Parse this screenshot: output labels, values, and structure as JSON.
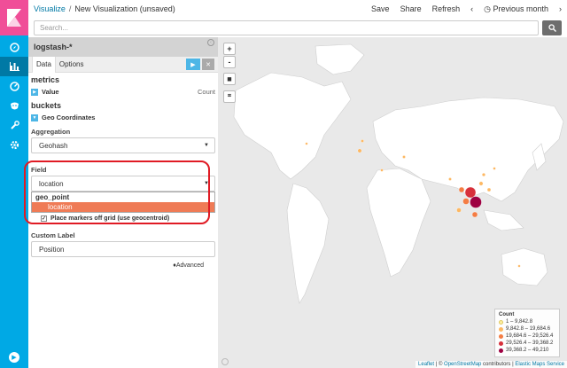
{
  "breadcrumb": {
    "root": "Visualize",
    "separator": "/",
    "current": "New Visualization (unsaved)"
  },
  "top_actions": {
    "save": "Save",
    "share": "Share",
    "refresh": "Refresh",
    "prev": "‹",
    "time_icon": "clock-icon",
    "time": "Previous month",
    "next": "›"
  },
  "search": {
    "placeholder": "Search...",
    "button_icon": "search-icon"
  },
  "nav": {
    "items": [
      "compass-icon",
      "chart-icon",
      "dashboard-icon",
      "timelion-icon",
      "wrench-icon",
      "gear-icon"
    ],
    "bottom_icon": "play-icon"
  },
  "panel": {
    "index_pattern": "logstash-*",
    "tabs": [
      {
        "label": "Data"
      },
      {
        "label": "Options"
      }
    ],
    "metrics_title": "metrics",
    "metric": {
      "label": "Value",
      "type": "Count"
    },
    "buckets_title": "buckets",
    "bucket": {
      "label": "Geo Coordinates"
    },
    "aggregation_label": "Aggregation",
    "aggregation_value": "Geohash",
    "field_label": "Field",
    "field_value": "location",
    "dropdown_group": "geo_point",
    "dropdown_option": "location",
    "checkbox_label": "Place markers off grid (use geocentroid)",
    "custom_label_title": "Custom Label",
    "custom_label_value": "Position",
    "advanced_link": "Advanced"
  },
  "map": {
    "zoom_in": "+",
    "zoom_out": "-",
    "legend": {
      "title": "Count",
      "items": [
        {
          "range": "1 – 9,842.8",
          "color": "#fef0a2"
        },
        {
          "range": "9,842.8 – 19,684.6",
          "color": "#fdb863"
        },
        {
          "range": "19,684.6 – 29,526.4",
          "color": "#f47d44"
        },
        {
          "range": "29,526.4 – 39,368.2",
          "color": "#d7303b"
        },
        {
          "range": "39,368.2 – 49,210",
          "color": "#9e0142"
        }
      ]
    },
    "attribution": {
      "leaflet": "Leaflet",
      "sep": " | © ",
      "osm": "OpenStreetMap",
      "contrib": " contributors | ",
      "ems": "Elastic Maps Service"
    }
  },
  "colors": {
    "nav": "#00a9e5",
    "logo": "#f04e98",
    "accent": "#0079a5",
    "selected_option": "#ef7b56",
    "highlight": "#e01b24"
  }
}
